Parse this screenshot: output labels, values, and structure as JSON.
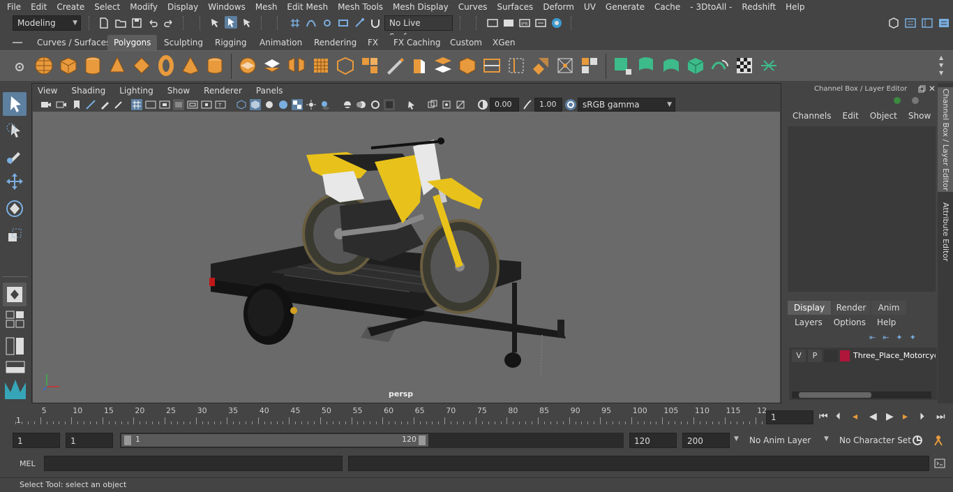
{
  "menubar": {
    "items": [
      "File",
      "Edit",
      "Create",
      "Select",
      "Modify",
      "Display",
      "Windows",
      "Mesh",
      "Edit Mesh",
      "Mesh Tools",
      "Mesh Display",
      "Curves",
      "Surfaces",
      "Deform",
      "UV",
      "Generate",
      "Cache",
      "- 3DtoAll -",
      "Redshift",
      "Help"
    ]
  },
  "status": {
    "mode": "Modeling",
    "live_surface": "No Live Surface"
  },
  "shelf": {
    "tabs": [
      "Curves / Surfaces",
      "Polygons",
      "Sculpting",
      "Rigging",
      "Animation",
      "Rendering",
      "FX",
      "FX Caching",
      "Custom",
      "XGen"
    ],
    "active": "Polygons"
  },
  "panel": {
    "menus": [
      "View",
      "Shading",
      "Lighting",
      "Show",
      "Renderer",
      "Panels"
    ],
    "exposure": "0.00",
    "gamma": "1.00",
    "color_space": "sRGB gamma",
    "camera_label": "persp"
  },
  "channelbox": {
    "title": "Channel Box / Layer Editor",
    "menus": [
      "Channels",
      "Edit",
      "Object",
      "Show"
    ],
    "layer_tabs": [
      "Display",
      "Render",
      "Anim"
    ],
    "active_layer_tab": "Display",
    "layer_menus": [
      "Layers",
      "Options",
      "Help"
    ],
    "layer": {
      "v": "V",
      "p": "P",
      "name": "Three_Place_Motorcycl",
      "color": "#b0153a"
    }
  },
  "side_tabs": [
    "Channel Box / Layer Editor",
    "Attribute Editor"
  ],
  "timeline": {
    "labels": [
      "5",
      "10",
      "15",
      "20",
      "25",
      "30",
      "35",
      "40",
      "45",
      "50",
      "55",
      "60",
      "65",
      "70",
      "75",
      "80",
      "85",
      "90",
      "95",
      "100",
      "105",
      "110",
      "115",
      "12"
    ],
    "start_marker": "1",
    "current_frame": "1"
  },
  "range": {
    "start": "1",
    "anim_start": "1",
    "slider_start": "1",
    "slider_end": "120",
    "range_end": "120",
    "anim_end": "200",
    "anim_layer": "No Anim Layer",
    "char_set": "No Character Set"
  },
  "cmd": {
    "lang": "MEL"
  },
  "help": {
    "text": "Select Tool: select an object"
  },
  "colors": {
    "accent": "#5d7fa0",
    "bike_yellow": "#e8c21a",
    "shelf_orange": "#e89a3c",
    "shelf_green": "#3dbb8a"
  }
}
